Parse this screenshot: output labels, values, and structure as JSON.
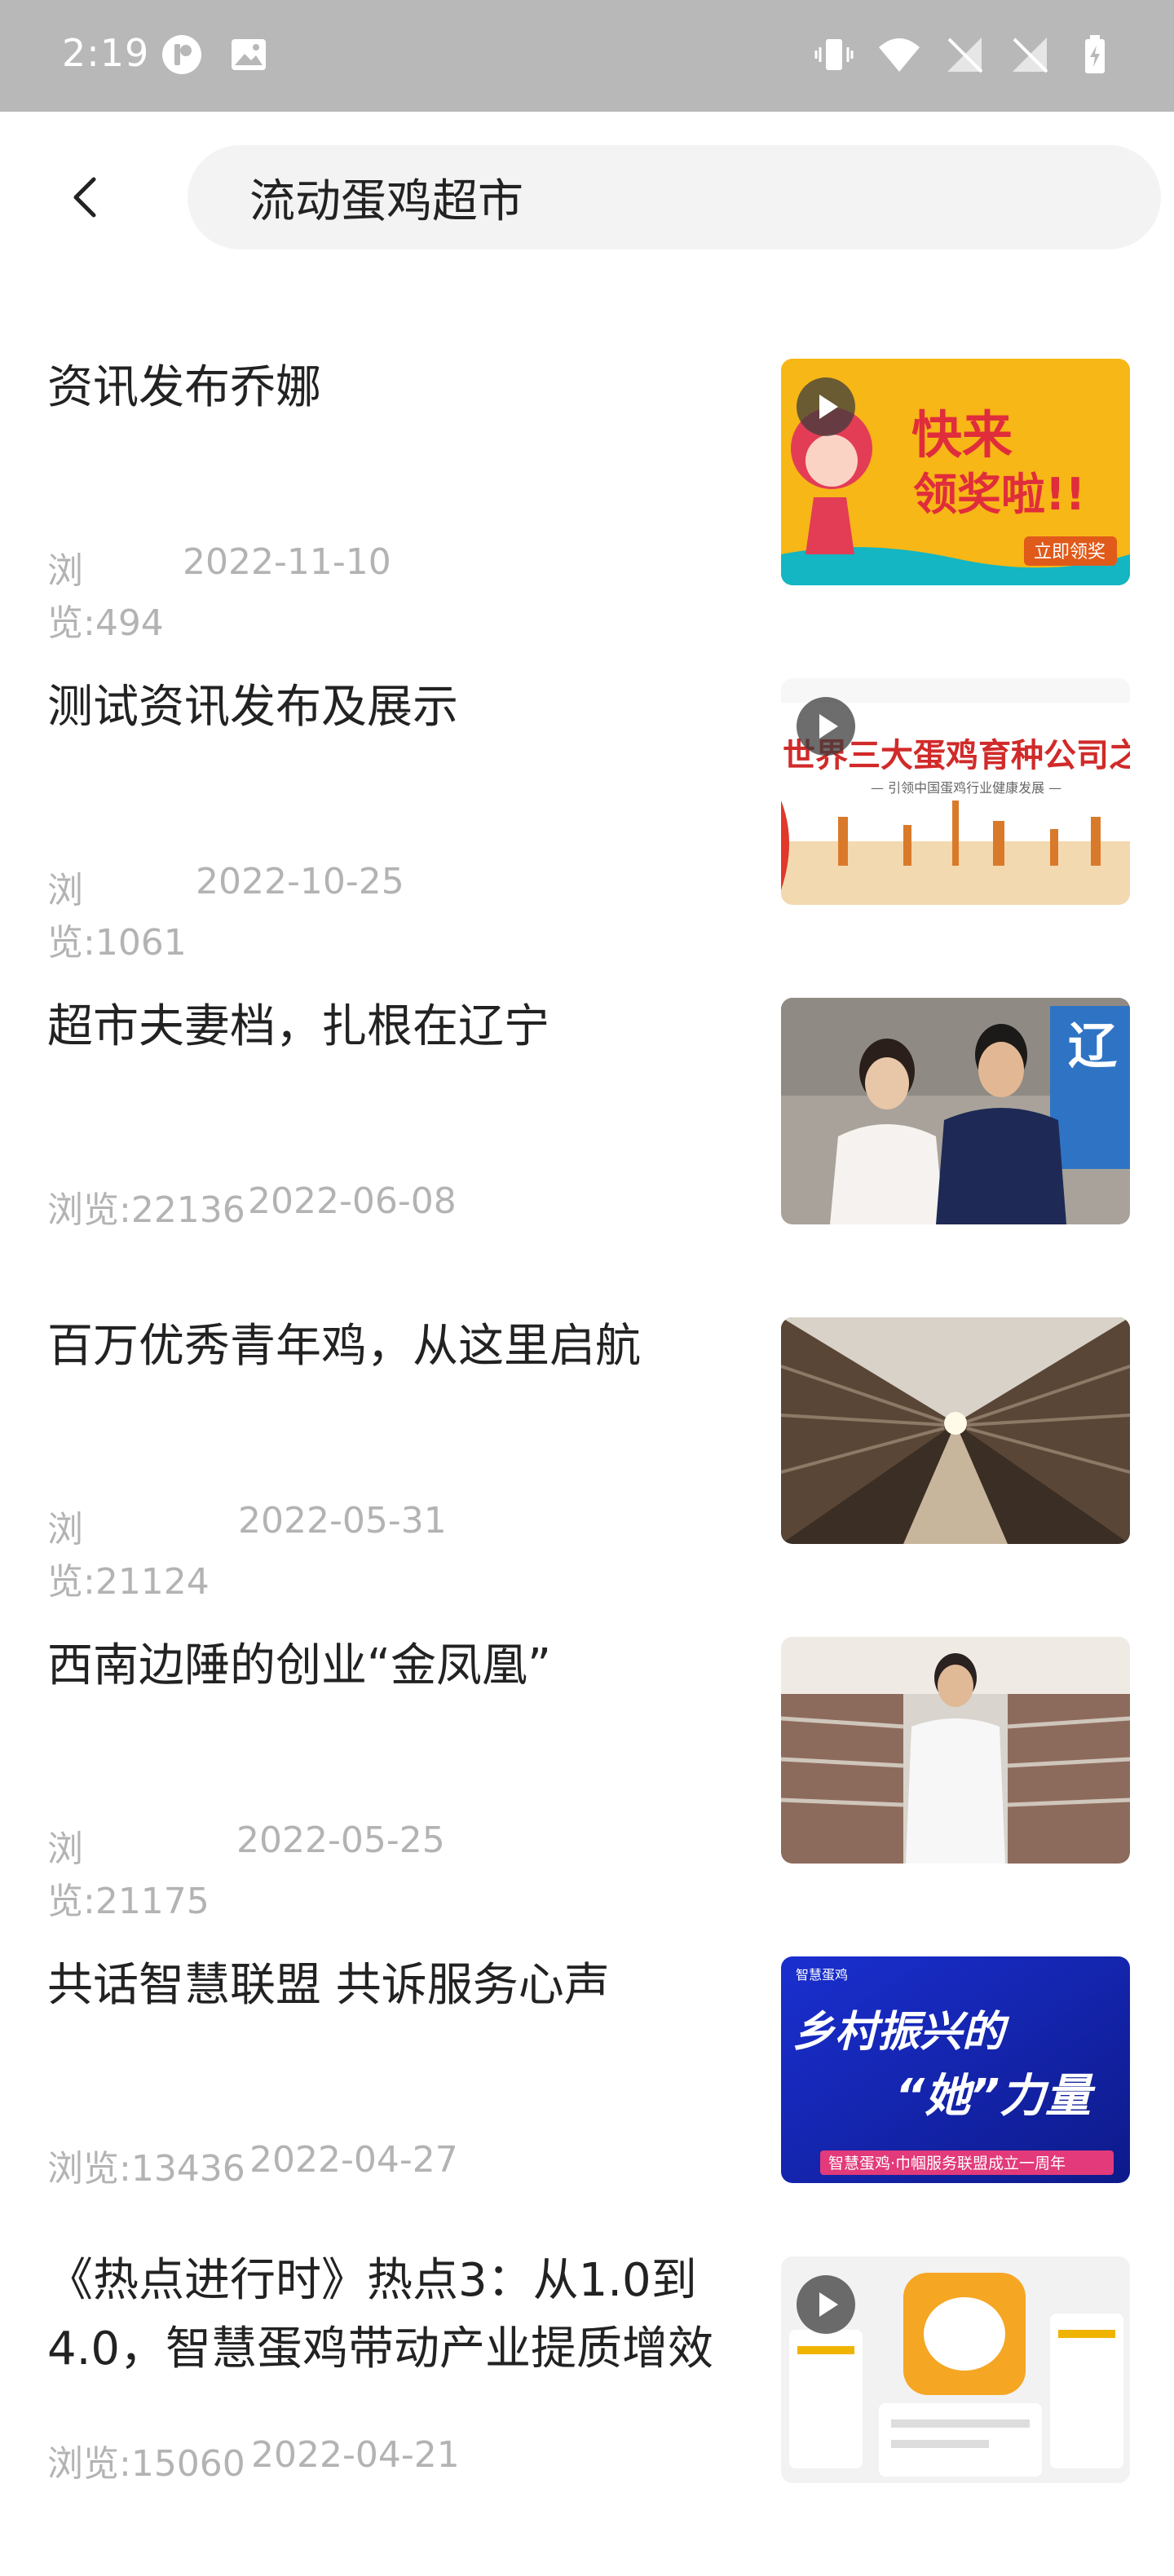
{
  "status_bar": {
    "time": "2:19"
  },
  "search": {
    "query": "流动蛋鸡超市"
  },
  "articles": [
    {
      "title": "资讯发布乔娜",
      "views": "浏览:494",
      "date": "2022-11-10",
      "thumb_text": [
        "快来",
        "领奖啦!!",
        "立即领奖"
      ],
      "has_video": true
    },
    {
      "title": "测试资讯发布及展示",
      "views": "浏览:1061",
      "date": "2022-10-25",
      "thumb_text": [
        "世界三大蛋鸡育种公司之一",
        "— 引领中国蛋鸡行业健康发展 —"
      ],
      "has_video": true
    },
    {
      "title": "超市夫妻档，扎根在辽宁",
      "views": "浏览:22136",
      "date": "2022-06-08",
      "thumb_text": [
        "辽"
      ],
      "has_video": false
    },
    {
      "title": "百万优秀青年鸡，从这里启航",
      "views": "浏览:21124",
      "date": "2022-05-31",
      "thumb_text": [],
      "has_video": false
    },
    {
      "title": "西南边陲的创业“金凤凰”",
      "views": "浏览:21175",
      "date": "2022-05-25",
      "thumb_text": [],
      "has_video": false
    },
    {
      "title": "共话智慧联盟 共诉服务心声",
      "views": "浏览:13436",
      "date": "2022-04-27",
      "thumb_text": [
        "智慧蛋鸡",
        "乡村振兴的",
        "“她”力量",
        "智慧蛋鸡·巾帼服务联盟成立一周年"
      ],
      "has_video": false
    },
    {
      "title": "《热点进行时》热点3：从1.0到4.0，智慧蛋鸡带动产业提质增效",
      "views": "浏览:15060",
      "date": "2022-04-21",
      "thumb_text": [],
      "has_video": true
    }
  ],
  "colors": {
    "status_bar": "#b8b8b8",
    "meta_text": "#b3b3b3",
    "search_bg": "#f3f3f3"
  }
}
